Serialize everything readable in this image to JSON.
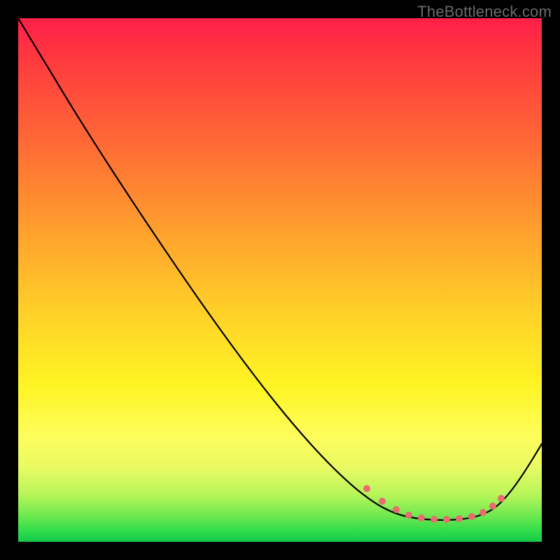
{
  "watermark": "TheBottleneck.com",
  "colors": {
    "background": "#000000",
    "gradient_top": "#ff1f49",
    "gradient_bottom": "#17c94b",
    "curve": "#000000",
    "marker": "#e96a6f"
  },
  "chart_data": {
    "type": "line",
    "title": "",
    "xlabel": "",
    "ylabel": "",
    "xlim": [
      0,
      100
    ],
    "ylim": [
      0,
      100
    ],
    "x": [
      0,
      4,
      10,
      20,
      30,
      40,
      50,
      60,
      68,
      72,
      76,
      78,
      80,
      82,
      84,
      86,
      88,
      90,
      92,
      96,
      100
    ],
    "values": [
      100,
      96,
      88,
      76,
      64,
      52,
      40,
      28,
      17,
      12,
      8,
      6.5,
      5.5,
      5,
      5,
      5,
      5.5,
      6.5,
      8.5,
      14,
      20
    ],
    "markers_x": [
      68,
      72,
      75,
      77,
      79,
      81,
      83,
      85,
      87,
      89,
      91,
      92
    ],
    "markers_y": [
      17,
      12,
      9,
      7,
      6,
      5.5,
      5,
      5,
      5.5,
      6.5,
      8.5,
      10
    ],
    "annotations": []
  }
}
